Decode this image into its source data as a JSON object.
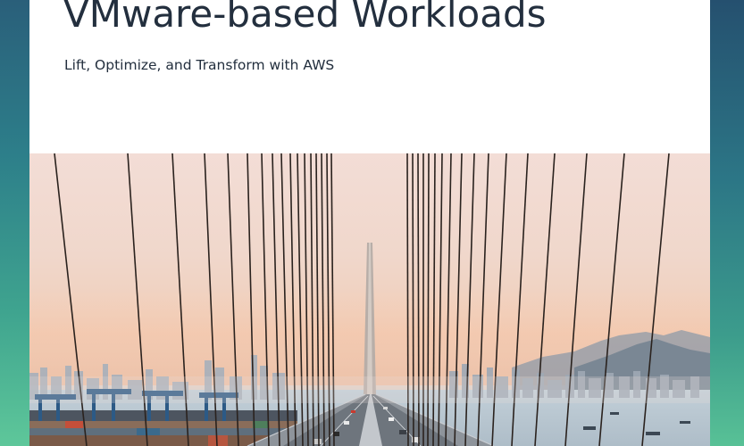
{
  "cover": {
    "title": "VMware-based Workloads",
    "subtitle": "Lift, Optimize, and Transform with AWS"
  },
  "colors": {
    "title_text": "#232f3e",
    "frame_top": "#2a5f7a",
    "frame_bottom": "#5ec79a"
  },
  "image": {
    "subject": "cable-stayed bridge at sunset"
  }
}
